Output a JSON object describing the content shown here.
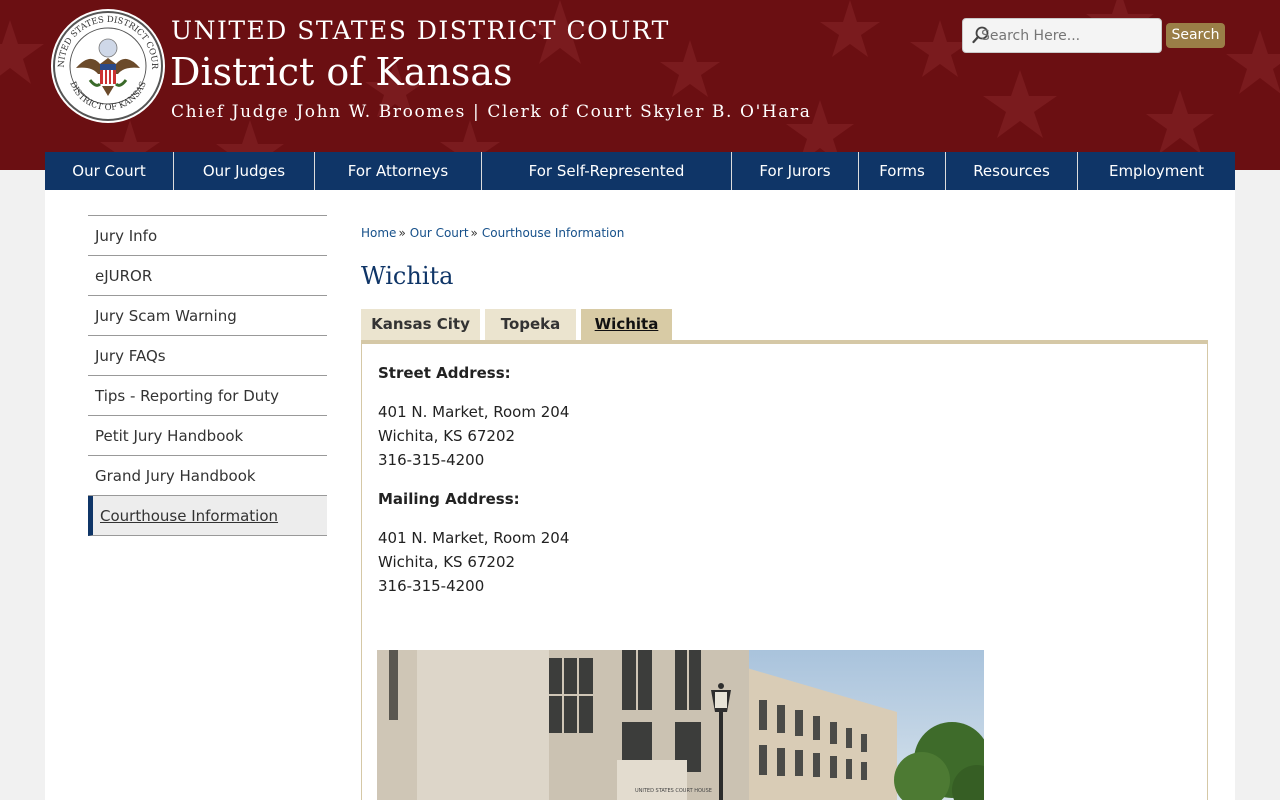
{
  "header": {
    "court_name": "UNITED STATES DISTRICT COURT",
    "district": "District of Kansas",
    "judges_line": "Chief Judge John W. Broomes | Clerk of Court Skyler B. O'Hara",
    "seal_text_top": "UNITED STATES DISTRICT COURT",
    "seal_text_bottom": "DISTRICT OF KANSAS"
  },
  "search": {
    "placeholder": "Search Here...",
    "button_label": "Search"
  },
  "nav": {
    "items": [
      {
        "label": "Our Court"
      },
      {
        "label": "Our Judges"
      },
      {
        "label": "For Attorneys"
      },
      {
        "label": "For Self-Represented"
      },
      {
        "label": "For Jurors"
      },
      {
        "label": "Forms"
      },
      {
        "label": "Resources"
      },
      {
        "label": "Employment"
      }
    ]
  },
  "sidebar": {
    "items": [
      {
        "label": "Jury Info"
      },
      {
        "label": "eJUROR"
      },
      {
        "label": "Jury Scam Warning"
      },
      {
        "label": "Jury FAQs"
      },
      {
        "label": "Tips - Reporting for Duty"
      },
      {
        "label": "Petit Jury Handbook"
      },
      {
        "label": "Grand Jury Handbook"
      },
      {
        "label": "Courthouse Information",
        "active": true
      }
    ]
  },
  "breadcrumb": {
    "items": [
      "Home",
      "Our Court",
      "Courthouse Information"
    ],
    "separator": "»"
  },
  "page": {
    "title": "Wichita"
  },
  "tabs": {
    "items": [
      {
        "label": "Kansas City"
      },
      {
        "label": "Topeka"
      },
      {
        "label": "Wichita",
        "active": true
      }
    ]
  },
  "wichita": {
    "street_label": "Street Address:",
    "street_lines": [
      "401 N. Market, Room 204",
      "Wichita, KS 67202",
      "316-315-4200"
    ],
    "mailing_label": "Mailing Address:",
    "mailing_lines": [
      "401 N. Market, Room 204",
      "Wichita, KS 67202",
      "316-315-4200"
    ],
    "photo_sign": "UNITED STATES COURT HOUSE"
  },
  "colors": {
    "header_bg": "#6b0f12",
    "nav_bg": "#0f3567",
    "tab_bg": "#ebe4cf",
    "tab_active_bg": "#d8cba5",
    "search_button_bg": "#9a7e47",
    "link": "#16508a"
  }
}
